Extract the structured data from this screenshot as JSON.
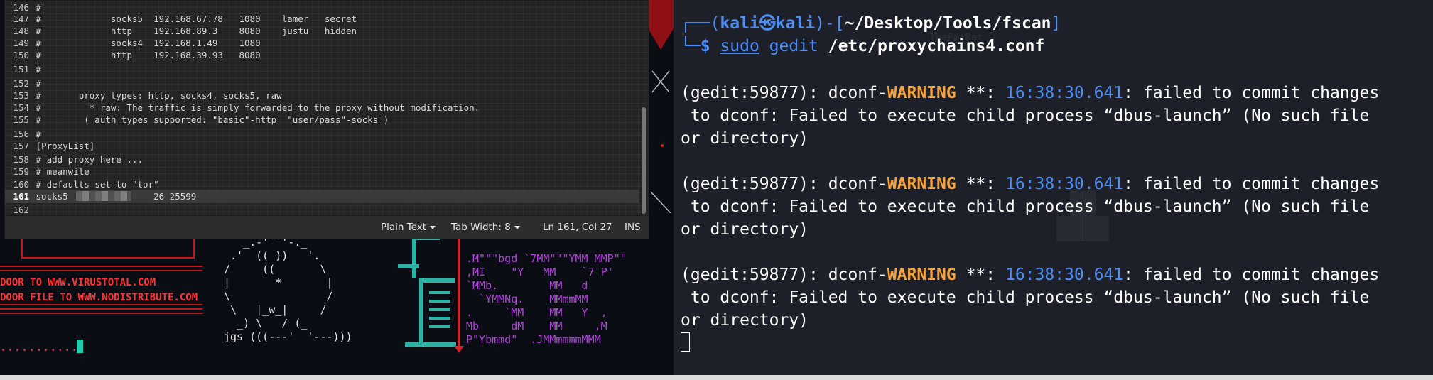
{
  "editor": {
    "lines": [
      {
        "num": "146",
        "text": " #"
      },
      {
        "num": "147",
        "text": " #             socks5  192.168.67.78   1080    lamer   secret"
      },
      {
        "num": "148",
        "text": " #             http    192.168.89.3    8080    justu   hidden"
      },
      {
        "num": "149",
        "text": " #             socks4  192.168.1.49    1080"
      },
      {
        "num": "150",
        "text": " #             http    192.168.39.93   8080"
      },
      {
        "num": "151",
        "text": " #"
      },
      {
        "num": "152",
        "text": " #"
      },
      {
        "num": "153",
        "text": " #       proxy types: http, socks4, socks5, raw"
      },
      {
        "num": "154",
        "text": " #         * raw: The traffic is simply forwarded to the proxy without modification."
      },
      {
        "num": "155",
        "text": " #        ( auth types supported: \"basic\"-http  \"user/pass\"-socks )"
      },
      {
        "num": "156",
        "text": " #"
      },
      {
        "num": "157",
        "text": " [ProxyList]"
      },
      {
        "num": "158",
        "text": " # add proxy here ..."
      },
      {
        "num": "159",
        "text": " # meanwile"
      },
      {
        "num": "160",
        "text": " # defaults set to \"tor\""
      },
      {
        "num": "161",
        "text": " socks5                26 25599"
      },
      {
        "num": "162",
        "text": ""
      }
    ],
    "status": {
      "syntax": "Plain Text",
      "tab_width": "Tab Width: 8",
      "position": "Ln 161, Col 27",
      "mode": "INS"
    }
  },
  "terminal": {
    "prompt": {
      "open": "┌──(",
      "user": "kali",
      "at_icon": "㉿",
      "host": "kali",
      "close": ")-[",
      "path": "~/Desktop/Tools/fscan",
      "end": "]",
      "second_prefix": "└─",
      "dollar": "$ ",
      "cmd_sudo": "sudo",
      "cmd_gedit": " gedit ",
      "cmd_arg": "/etc/proxychains4.conf"
    },
    "warnings": [
      {
        "prefix": "(gedit:59877): dconf-",
        "level": "WARNING",
        "stars": " **: ",
        "time": "16:38:30.641",
        "msg1": ": failed to commit changes",
        "msg2": " to dconf: Failed to execute child process “dbus-launch” (No such file",
        "msg3": "or directory)"
      },
      {
        "prefix": "(gedit:59877): dconf-",
        "level": "WARNING",
        "stars": " **: ",
        "time": "16:38:30.641",
        "msg1": ": failed to commit changes",
        "msg2": " to dconf: Failed to execute child process “dbus-launch” (No such file",
        "msg3": "or directory)"
      },
      {
        "prefix": "(gedit:59877): dconf-",
        "level": "WARNING",
        "stars": " **: ",
        "time": "16:38:30.641",
        "msg1": ": failed to commit changes",
        "msg2": " to dconf: Failed to execute child process “dbus-launch” (No such file",
        "msg3": "or directory)"
      }
    ]
  },
  "desktop": {
    "red_line_1": "DOOR TO WWW.VIRUSTOTAL.COM",
    "red_line_2": "DOOR FILE TO WWW.NODISTRIBUTE.COM",
    "dots": "...........",
    "frog_art": "   _.-'``'-._ \n .'  (( ))   '. \n/     ((       \\\n|       *       |\n\\               /\n \\   |_w_|     /\n  _) \\   / (_  \njgs (((---'  '---)))",
    "purple_art": ".M\"\"\"bgd `7MM\"\"\"YMM MMP\"\"\n,MI    \"Y   MM    `7 P'\n`MMb.        MM   d\n  `YMMNq.    MMmmMM\n.     `MM    MM   Y  ,\nMb     dM    MM     ,M\nP\"Ybmmd\"  .JMMmmmmMMM"
  }
}
